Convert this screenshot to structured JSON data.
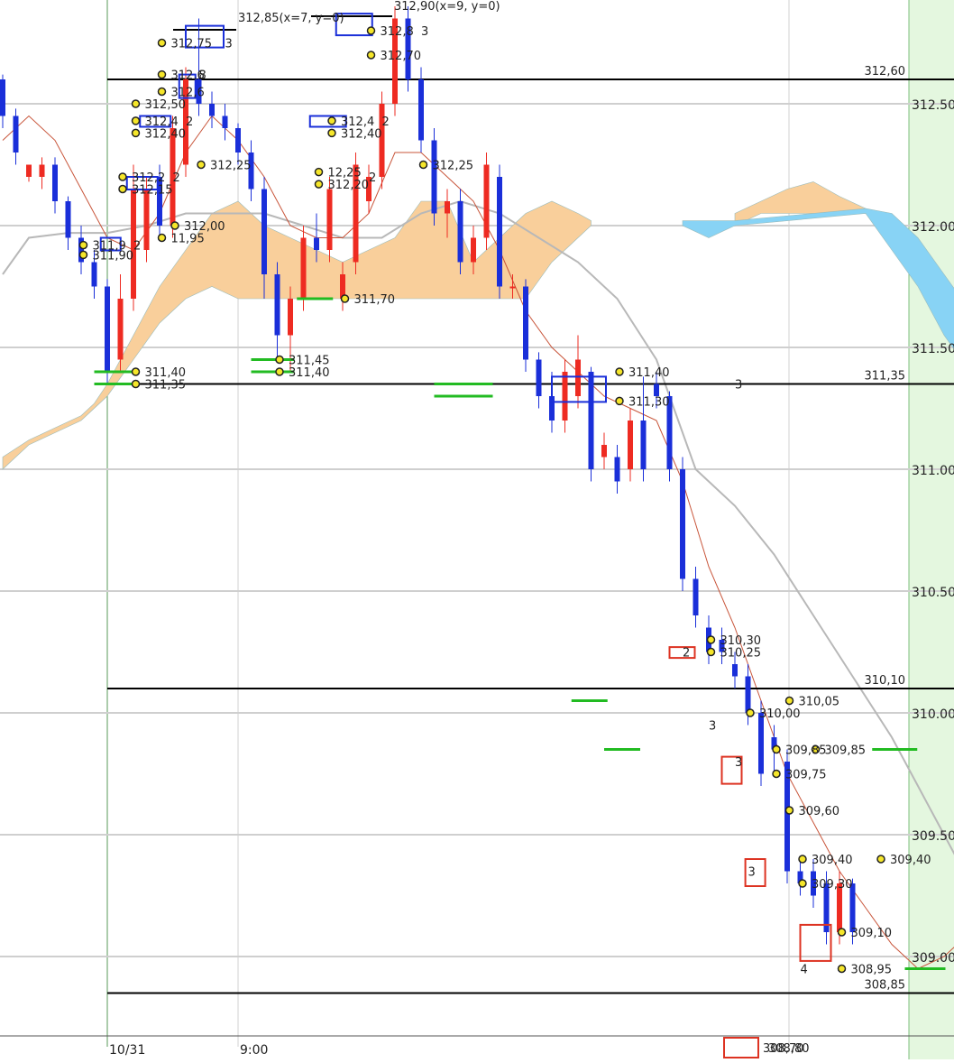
{
  "chart_data": {
    "type": "candlestick",
    "y_axis": {
      "ticks": [
        {
          "value": 312.5,
          "label": "312.50"
        },
        {
          "value": 312.0,
          "label": "312.00"
        },
        {
          "value": 311.5,
          "label": "311.50"
        },
        {
          "value": 311.0,
          "label": "311.00"
        },
        {
          "value": 310.5,
          "label": "310.50"
        },
        {
          "value": 310.0,
          "label": "310.00"
        },
        {
          "value": 309.5,
          "label": "309.50"
        },
        {
          "value": 309.0,
          "label": "309.00"
        }
      ]
    },
    "x_axis": {
      "ticks": [
        {
          "index": 0,
          "label": "10/31"
        },
        {
          "index": 10,
          "label": "9:00"
        }
      ]
    },
    "horizontal_levels": [
      {
        "value": 312.6,
        "label": "312,60"
      },
      {
        "value": 311.35,
        "label": "311,35"
      },
      {
        "value": 310.1,
        "label": "310,10"
      },
      {
        "value": 308.85,
        "label": "308,85"
      }
    ],
    "peak_notes": [
      {
        "text": "312,85(x=7, y=0)"
      },
      {
        "text": "312,90(x=9, y=0)"
      }
    ],
    "candles": [
      {
        "i": -8,
        "o": 312.6,
        "h": 312.62,
        "c": 312.45,
        "l": 312.4
      },
      {
        "i": -7,
        "o": 312.45,
        "h": 312.48,
        "c": 312.3,
        "l": 312.25
      },
      {
        "i": -6,
        "o": 312.2,
        "h": 312.25,
        "c": 312.25,
        "l": 312.18
      },
      {
        "i": -5,
        "o": 312.2,
        "h": 312.28,
        "c": 312.25,
        "l": 312.15
      },
      {
        "i": -4,
        "o": 312.25,
        "h": 312.28,
        "c": 312.1,
        "l": 312.05
      },
      {
        "i": -3,
        "o": 312.1,
        "h": 312.12,
        "c": 311.95,
        "l": 311.9
      },
      {
        "i": -2,
        "o": 311.95,
        "h": 312.0,
        "c": 311.85,
        "l": 311.8
      },
      {
        "i": -1,
        "o": 311.85,
        "h": 311.9,
        "c": 311.75,
        "l": 311.7
      },
      {
        "i": 0,
        "o": 311.75,
        "h": 311.78,
        "c": 311.4,
        "l": 311.35
      },
      {
        "i": 1,
        "o": 311.45,
        "h": 311.8,
        "c": 311.7,
        "l": 311.4
      },
      {
        "i": 2,
        "o": 311.7,
        "h": 312.25,
        "c": 312.15,
        "l": 311.65
      },
      {
        "i": 3,
        "o": 311.9,
        "h": 312.2,
        "c": 312.15,
        "l": 311.85
      },
      {
        "i": 4,
        "o": 312.2,
        "h": 312.25,
        "c": 312.0,
        "l": 311.95
      },
      {
        "i": 5,
        "o": 312.0,
        "h": 312.45,
        "c": 312.4,
        "l": 311.95
      },
      {
        "i": 6,
        "o": 312.25,
        "h": 312.65,
        "c": 312.6,
        "l": 312.2
      },
      {
        "i": 7,
        "o": 312.6,
        "h": 312.85,
        "c": 312.5,
        "l": 312.45
      },
      {
        "i": 8,
        "o": 312.5,
        "h": 312.55,
        "c": 312.45,
        "l": 312.4
      },
      {
        "i": 9,
        "o": 312.45,
        "h": 312.5,
        "c": 312.4,
        "l": 312.35
      },
      {
        "i": 10,
        "o": 312.4,
        "h": 312.42,
        "c": 312.3,
        "l": 312.25
      },
      {
        "i": 11,
        "o": 312.3,
        "h": 312.35,
        "c": 312.15,
        "l": 312.1
      },
      {
        "i": 12,
        "o": 312.15,
        "h": 312.2,
        "c": 311.8,
        "l": 311.7
      },
      {
        "i": 13,
        "o": 311.8,
        "h": 311.85,
        "c": 311.55,
        "l": 311.45
      },
      {
        "i": 14,
        "o": 311.55,
        "h": 311.75,
        "c": 311.7,
        "l": 311.4
      },
      {
        "i": 15,
        "o": 311.7,
        "h": 312.0,
        "c": 311.95,
        "l": 311.65
      },
      {
        "i": 16,
        "o": 311.95,
        "h": 312.05,
        "c": 311.9,
        "l": 311.85
      },
      {
        "i": 17,
        "o": 311.9,
        "h": 312.2,
        "c": 312.15,
        "l": 311.85
      },
      {
        "i": 18,
        "o": 311.7,
        "h": 311.85,
        "c": 311.8,
        "l": 311.65
      },
      {
        "i": 19,
        "o": 311.85,
        "h": 312.3,
        "c": 312.25,
        "l": 311.8
      },
      {
        "i": 20,
        "o": 312.1,
        "h": 312.25,
        "c": 312.2,
        "l": 312.05
      },
      {
        "i": 21,
        "o": 312.2,
        "h": 312.55,
        "c": 312.5,
        "l": 312.15
      },
      {
        "i": 22,
        "o": 312.5,
        "h": 312.9,
        "c": 312.85,
        "l": 312.45
      },
      {
        "i": 23,
        "o": 312.85,
        "h": 312.9,
        "c": 312.6,
        "l": 312.55
      },
      {
        "i": 24,
        "o": 312.6,
        "h": 312.65,
        "c": 312.35,
        "l": 312.3
      },
      {
        "i": 25,
        "o": 312.35,
        "h": 312.4,
        "c": 312.05,
        "l": 312.0
      },
      {
        "i": 26,
        "o": 312.05,
        "h": 312.15,
        "c": 312.1,
        "l": 311.95
      },
      {
        "i": 27,
        "o": 312.1,
        "h": 312.15,
        "c": 311.85,
        "l": 311.8
      },
      {
        "i": 28,
        "o": 311.85,
        "h": 312.0,
        "c": 311.95,
        "l": 311.8
      },
      {
        "i": 29,
        "o": 311.95,
        "h": 312.3,
        "c": 312.25,
        "l": 311.9
      },
      {
        "i": 30,
        "o": 312.2,
        "h": 312.25,
        "c": 311.75,
        "l": 311.7
      },
      {
        "i": 31,
        "o": 311.75,
        "h": 311.8,
        "c": 311.75,
        "l": 311.7
      },
      {
        "i": 32,
        "o": 311.75,
        "h": 311.78,
        "c": 311.45,
        "l": 311.4
      },
      {
        "i": 33,
        "o": 311.45,
        "h": 311.48,
        "c": 311.3,
        "l": 311.25
      },
      {
        "i": 34,
        "o": 311.3,
        "h": 311.4,
        "c": 311.2,
        "l": 311.15
      },
      {
        "i": 35,
        "o": 311.2,
        "h": 311.45,
        "c": 311.4,
        "l": 311.15
      },
      {
        "i": 36,
        "o": 311.3,
        "h": 311.55,
        "c": 311.45,
        "l": 311.25
      },
      {
        "i": 37,
        "o": 311.4,
        "h": 311.42,
        "c": 311.0,
        "l": 310.95
      },
      {
        "i": 38,
        "o": 311.05,
        "h": 311.15,
        "c": 311.1,
        "l": 311.0
      },
      {
        "i": 39,
        "o": 311.05,
        "h": 311.1,
        "c": 310.95,
        "l": 310.9
      },
      {
        "i": 40,
        "o": 311.0,
        "h": 311.25,
        "c": 311.2,
        "l": 310.95
      },
      {
        "i": 41,
        "o": 311.2,
        "h": 311.38,
        "c": 311.0,
        "l": 310.95
      },
      {
        "i": 42,
        "o": 311.35,
        "h": 311.4,
        "c": 311.3,
        "l": 311.25
      },
      {
        "i": 43,
        "o": 311.3,
        "h": 311.32,
        "c": 311.0,
        "l": 310.95
      },
      {
        "i": 44,
        "o": 311.0,
        "h": 311.05,
        "c": 310.55,
        "l": 310.5
      },
      {
        "i": 45,
        "o": 310.55,
        "h": 310.6,
        "c": 310.4,
        "l": 310.35
      },
      {
        "i": 46,
        "o": 310.35,
        "h": 310.4,
        "c": 310.25,
        "l": 310.2
      },
      {
        "i": 47,
        "o": 310.3,
        "h": 310.35,
        "c": 310.25,
        "l": 310.2
      },
      {
        "i": 48,
        "o": 310.2,
        "h": 310.25,
        "c": 310.15,
        "l": 310.1
      },
      {
        "i": 49,
        "o": 310.15,
        "h": 310.2,
        "c": 310.0,
        "l": 309.95
      },
      {
        "i": 50,
        "o": 310.0,
        "h": 310.05,
        "c": 309.75,
        "l": 309.7
      },
      {
        "i": 51,
        "o": 309.9,
        "h": 309.95,
        "c": 309.85,
        "l": 309.75
      },
      {
        "i": 52,
        "o": 309.8,
        "h": 309.85,
        "c": 309.35,
        "l": 309.3
      },
      {
        "i": 53,
        "o": 309.35,
        "h": 309.4,
        "c": 309.3,
        "l": 309.25
      },
      {
        "i": 54,
        "o": 309.35,
        "h": 309.4,
        "c": 309.25,
        "l": 309.2
      },
      {
        "i": 55,
        "o": 309.3,
        "h": 309.35,
        "c": 309.1,
        "l": 309.05
      },
      {
        "i": 56,
        "o": 309.1,
        "h": 309.35,
        "c": 309.3,
        "l": 309.05
      },
      {
        "i": 57,
        "o": 309.3,
        "h": 309.32,
        "c": 309.1,
        "l": 309.05
      }
    ],
    "fast_line": [
      [
        -8,
        312.35
      ],
      [
        -6,
        312.45
      ],
      [
        -4,
        312.35
      ],
      [
        -2,
        312.15
      ],
      [
        0,
        311.95
      ],
      [
        2,
        311.9
      ],
      [
        4,
        312.05
      ],
      [
        6,
        312.3
      ],
      [
        8,
        312.45
      ],
      [
        10,
        312.35
      ],
      [
        12,
        312.2
      ],
      [
        14,
        312.0
      ],
      [
        16,
        311.95
      ],
      [
        18,
        311.95
      ],
      [
        20,
        312.05
      ],
      [
        22,
        312.3
      ],
      [
        24,
        312.3
      ],
      [
        26,
        312.2
      ],
      [
        28,
        312.1
      ],
      [
        30,
        311.9
      ],
      [
        32,
        311.65
      ],
      [
        34,
        311.5
      ],
      [
        36,
        311.4
      ],
      [
        38,
        311.3
      ],
      [
        40,
        311.25
      ],
      [
        42,
        311.2
      ],
      [
        44,
        310.95
      ],
      [
        46,
        310.6
      ],
      [
        48,
        310.35
      ],
      [
        50,
        310.05
      ],
      [
        52,
        309.75
      ],
      [
        54,
        309.55
      ],
      [
        56,
        309.35
      ],
      [
        58,
        309.2
      ],
      [
        60,
        309.05
      ],
      [
        62,
        308.95
      ],
      [
        64,
        309.0
      ],
      [
        66,
        309.1
      ],
      [
        68,
        309.1
      ],
      [
        70,
        309.2
      ],
      [
        72,
        309.25
      ],
      [
        74,
        309.25
      ],
      [
        76,
        309.05
      ]
    ],
    "slow_line": [
      [
        -8,
        311.8
      ],
      [
        -6,
        311.95
      ],
      [
        -3,
        311.97
      ],
      [
        0,
        311.97
      ],
      [
        3,
        312.0
      ],
      [
        6,
        312.05
      ],
      [
        9,
        312.05
      ],
      [
        12,
        312.05
      ],
      [
        15,
        312.0
      ],
      [
        18,
        311.95
      ],
      [
        21,
        311.95
      ],
      [
        24,
        312.05
      ],
      [
        27,
        312.1
      ],
      [
        30,
        312.05
      ],
      [
        33,
        311.95
      ],
      [
        36,
        311.85
      ],
      [
        39,
        311.7
      ],
      [
        42,
        311.45
      ],
      [
        45,
        311.0
      ],
      [
        48,
        310.85
      ],
      [
        51,
        310.65
      ],
      [
        54,
        310.4
      ],
      [
        57,
        310.15
      ],
      [
        60,
        309.9
      ],
      [
        63,
        309.6
      ],
      [
        66,
        309.3
      ],
      [
        69,
        309.05
      ],
      [
        72,
        309.05
      ],
      [
        75,
        309.15
      ],
      [
        76,
        309.15
      ]
    ],
    "cloud_orange": [
      [
        -8,
        311.0,
        311.05
      ],
      [
        -6,
        311.1,
        311.12
      ],
      [
        -4,
        311.15,
        311.17
      ],
      [
        -2,
        311.2,
        311.22
      ],
      [
        -1,
        311.25,
        311.27
      ],
      [
        0,
        311.3,
        311.35
      ],
      [
        2,
        311.45,
        311.55
      ],
      [
        4,
        311.6,
        311.75
      ],
      [
        6,
        311.7,
        311.9
      ],
      [
        8,
        311.75,
        312.05
      ],
      [
        10,
        311.7,
        312.1
      ],
      [
        12,
        311.7,
        312.0
      ],
      [
        14,
        311.7,
        311.95
      ],
      [
        16,
        311.7,
        311.9
      ],
      [
        18,
        311.7,
        311.85
      ],
      [
        20,
        311.7,
        311.9
      ],
      [
        22,
        311.7,
        311.95
      ],
      [
        24,
        311.7,
        312.1
      ],
      [
        26,
        311.7,
        312.1
      ],
      [
        28,
        311.7,
        311.85
      ],
      [
        30,
        311.7,
        311.95
      ],
      [
        32,
        311.7,
        312.05
      ],
      [
        34,
        311.85,
        312.1
      ],
      [
        36,
        311.95,
        312.05
      ],
      [
        37,
        312.0,
        312.02
      ]
    ],
    "cloud_orange_2": [
      [
        48,
        312.0,
        312.05
      ],
      [
        50,
        312.05,
        312.1
      ],
      [
        52,
        312.05,
        312.15
      ],
      [
        54,
        312.05,
        312.18
      ],
      [
        56,
        312.05,
        312.12
      ],
      [
        58,
        312.05,
        312.07
      ]
    ],
    "cloud_blue": [
      [
        44,
        312.0,
        312.02
      ],
      [
        46,
        311.95,
        312.02
      ],
      [
        48,
        312.0,
        312.02
      ],
      [
        58,
        312.05,
        312.07
      ],
      [
        60,
        311.9,
        312.05
      ],
      [
        62,
        311.75,
        311.95
      ],
      [
        64,
        311.55,
        311.8
      ],
      [
        66,
        311.4,
        311.65
      ],
      [
        68,
        311.2,
        311.5
      ],
      [
        70,
        311.0,
        311.35
      ],
      [
        72,
        310.9,
        311.1
      ],
      [
        74,
        310.85,
        311.0
      ],
      [
        76,
        310.85,
        310.95
      ],
      [
        78,
        310.85,
        310.9
      ],
      [
        80,
        310.85,
        310.87
      ]
    ],
    "cloud_blue_2": [
      [
        72,
        310.85,
        310.86
      ],
      [
        74,
        310.4,
        310.85
      ],
      [
        76,
        310.0,
        310.85
      ],
      [
        78,
        309.75,
        310.85
      ],
      [
        80,
        309.5,
        310.85
      ]
    ],
    "order_labels": [
      {
        "i": 21,
        "v": 312.8,
        "text": "312,8"
      },
      {
        "i": 21,
        "v": 312.7,
        "text": "312,70"
      },
      {
        "i": 5,
        "v": 312.75,
        "text": "312,75"
      },
      {
        "i": 5,
        "v": 312.62,
        "text": "312,6"
      },
      {
        "i": 5,
        "v": 312.55,
        "text": "312,6"
      },
      {
        "i": 3,
        "v": 312.5,
        "text": "312,50"
      },
      {
        "i": 3,
        "v": 312.43,
        "text": "312,4"
      },
      {
        "i": 3,
        "v": 312.38,
        "text": "312,40"
      },
      {
        "i": 18,
        "v": 312.43,
        "text": "312,4"
      },
      {
        "i": 18,
        "v": 312.38,
        "text": "312,40"
      },
      {
        "i": 8,
        "v": 312.25,
        "text": "312,25"
      },
      {
        "i": 25,
        "v": 312.25,
        "text": "312,25"
      },
      {
        "i": 17,
        "v": 312.22,
        "text": "12,25"
      },
      {
        "i": 17,
        "v": 312.17,
        "text": "312,20"
      },
      {
        "i": 2,
        "v": 312.2,
        "text": "312,2"
      },
      {
        "i": 2,
        "v": 312.15,
        "text": "312,15"
      },
      {
        "i": 6,
        "v": 312.0,
        "text": "312,00"
      },
      {
        "i": 5,
        "v": 311.95,
        "text": "11,95"
      },
      {
        "i": -1,
        "v": 311.92,
        "text": "311,9"
      },
      {
        "i": -1,
        "v": 311.88,
        "text": "311,90"
      },
      {
        "i": 19,
        "v": 311.7,
        "text": "311,70"
      },
      {
        "i": 14,
        "v": 311.45,
        "text": "311,45"
      },
      {
        "i": 14,
        "v": 311.4,
        "text": "311,40"
      },
      {
        "i": 3,
        "v": 311.4,
        "text": "311,40"
      },
      {
        "i": 3,
        "v": 311.35,
        "text": "311,35"
      },
      {
        "i": 40,
        "v": 311.4,
        "text": "311,40"
      },
      {
        "i": 40,
        "v": 311.28,
        "text": "311,30"
      },
      {
        "i": 47,
        "v": 310.3,
        "text": "310,30"
      },
      {
        "i": 47,
        "v": 310.25,
        "text": "310,25"
      },
      {
        "i": 53,
        "v": 310.05,
        "text": "310,05"
      },
      {
        "i": 50,
        "v": 310.0,
        "text": "310,00"
      },
      {
        "i": 55,
        "v": 309.85,
        "text": "309,85"
      },
      {
        "i": 52,
        "v": 309.85,
        "text": "309,85"
      },
      {
        "i": 52,
        "v": 309.75,
        "text": "309,75"
      },
      {
        "i": 53,
        "v": 309.6,
        "text": "309,60"
      },
      {
        "i": 60,
        "v": 309.4,
        "text": "309,40"
      },
      {
        "i": 54,
        "v": 309.4,
        "text": "309,40"
      },
      {
        "i": 54,
        "v": 309.3,
        "text": "309,30"
      },
      {
        "i": 57,
        "v": 309.1,
        "text": "309,10"
      },
      {
        "i": 57,
        "v": 308.95,
        "text": "308,95"
      },
      {
        "i": 80,
        "v": 309.85,
        "text": "309"
      }
    ],
    "count_labels": [
      {
        "i": 24,
        "v": 312.8,
        "text": "3"
      },
      {
        "i": 9,
        "v": 312.75,
        "text": "3"
      },
      {
        "i": 7,
        "v": 312.62,
        "text": "8"
      },
      {
        "i": 6,
        "v": 312.43,
        "text": "2"
      },
      {
        "i": 21,
        "v": 312.43,
        "text": "2"
      },
      {
        "i": 20,
        "v": 312.2,
        "text": "2"
      },
      {
        "i": 5,
        "v": 312.2,
        "text": "2"
      },
      {
        "i": 2,
        "v": 311.92,
        "text": "2"
      },
      {
        "i": 48,
        "v": 311.35,
        "text": "3"
      },
      {
        "i": 44,
        "v": 310.25,
        "text": "2"
      },
      {
        "i": 46,
        "v": 309.95,
        "text": "3"
      },
      {
        "i": 48,
        "v": 309.8,
        "text": "3"
      },
      {
        "i": 49,
        "v": 309.35,
        "text": "3"
      },
      {
        "i": 53,
        "v": 308.95,
        "text": "4"
      }
    ],
    "bottom_labels": [
      {
        "text": "308,70"
      },
      {
        "text": "308,80"
      }
    ]
  }
}
